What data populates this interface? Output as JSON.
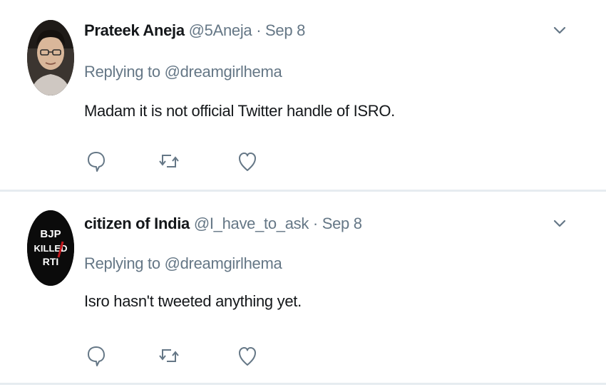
{
  "tweets": [
    {
      "name": "Prateek Aneja",
      "handle": "@5Aneja",
      "separator": "·",
      "date": "Sep 8",
      "replying_prefix": "Replying to",
      "replying_to": "@dreamgirlhema",
      "text": "Madam it is not official Twitter handle of ISRO.",
      "avatar": "profile-photo"
    },
    {
      "name": "citizen of India",
      "handle": "@I_have_to_ask",
      "separator": "·",
      "date": "Sep 8",
      "replying_prefix": "Replying to",
      "replying_to": "@dreamgirlhema",
      "text": "Isro hasn't tweeted anything yet.",
      "avatar": "bjp-killed-rti-logo",
      "avatar_text": [
        "BJP",
        "KILLED",
        "RTI"
      ]
    }
  ],
  "icons": {
    "reply": "reply-icon",
    "retweet": "retweet-icon",
    "like": "like-icon",
    "more": "chevron-down-icon"
  },
  "colors": {
    "name": "#14171a",
    "secondary": "#657786",
    "divider": "#e6ecf0",
    "icon": "#657786"
  }
}
